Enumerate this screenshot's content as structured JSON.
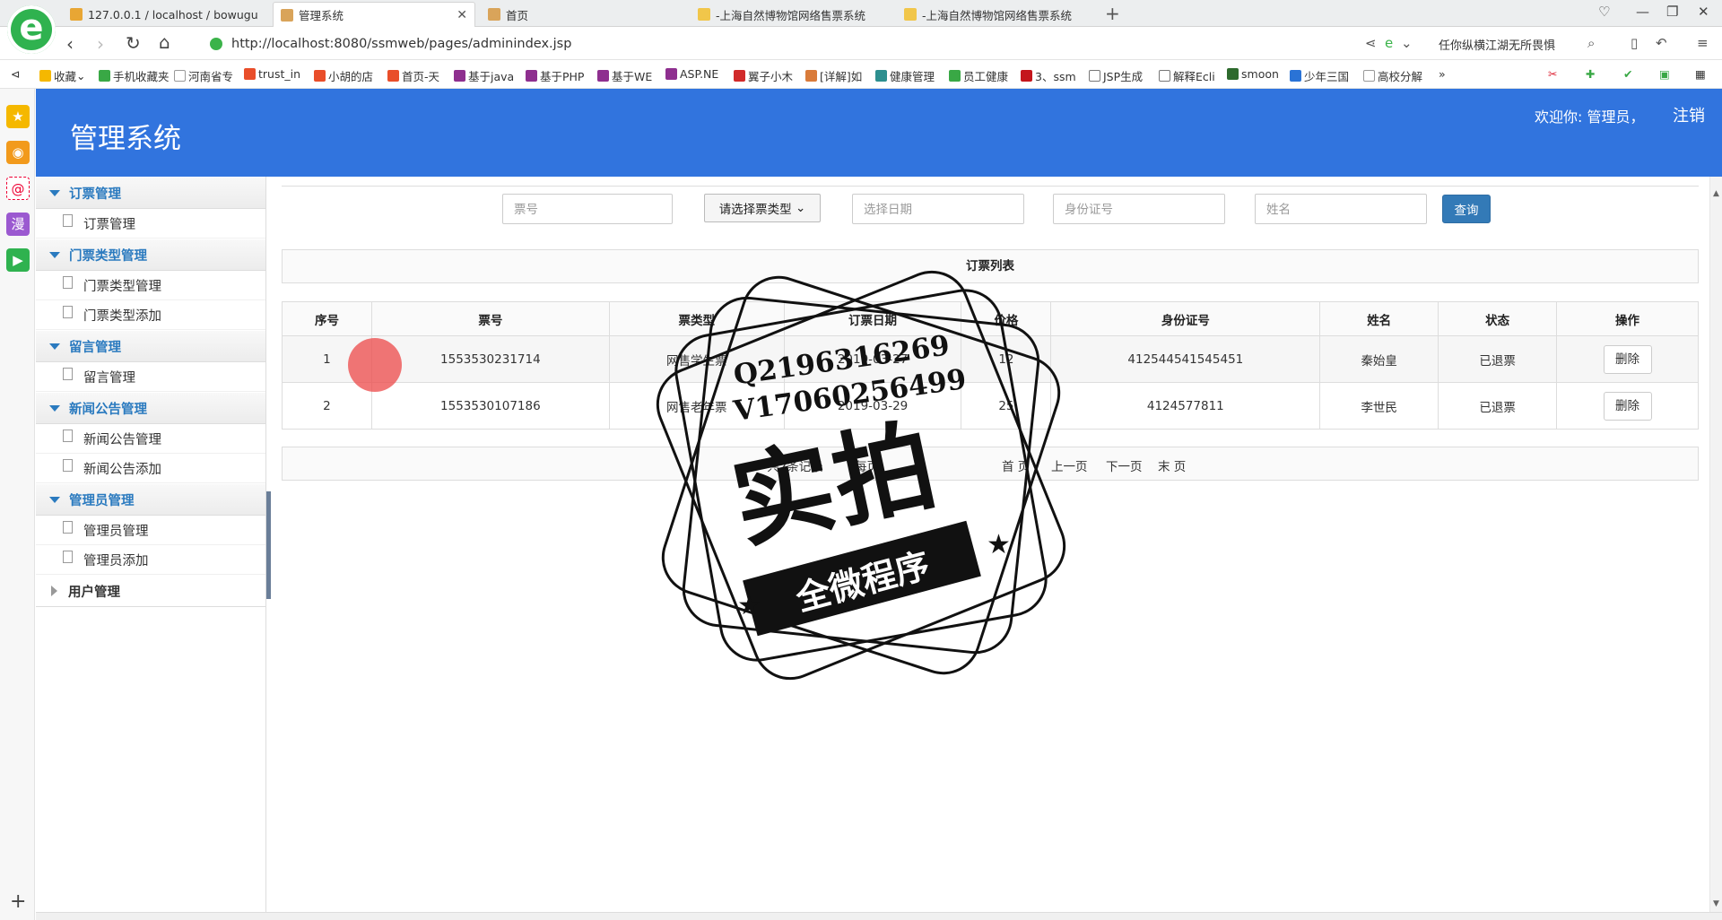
{
  "browser": {
    "tabs": [
      {
        "label": "127.0.0.1 / localhost / bowugu",
        "active": false
      },
      {
        "label": "管理系统",
        "active": true
      },
      {
        "label": "首页",
        "active": false
      },
      {
        "label": "-上海自然博物馆网络售票系统",
        "active": false
      },
      {
        "label": "-上海自然博物馆网络售票系统",
        "active": false
      }
    ],
    "url": "http://localhost:8080/ssmweb/pages/adminindex.jsp",
    "addr_right_text": "任你纵横江湖无所畏惧",
    "bookmarks": [
      "收藏",
      "手机收藏夹",
      "河南省专",
      "trust_in",
      "小胡的店",
      "首页-天",
      "基于java",
      "基于PHP",
      "基于WE",
      "ASP.NE",
      "翼子小木",
      "[详解]如",
      "健康管理",
      "员工健康",
      "3、ssm",
      "JSP生成",
      "解释Ecli",
      "smoon",
      "少年三国",
      "高校分解"
    ]
  },
  "header": {
    "title": "管理系统",
    "welcome": "欢迎你: 管理员，",
    "logout": "注销"
  },
  "sidebar": {
    "groups": [
      {
        "label": "订票管理",
        "items": [
          "订票管理"
        ]
      },
      {
        "label": "门票类型管理",
        "items": [
          "门票类型管理",
          "门票类型添加"
        ]
      },
      {
        "label": "留言管理",
        "items": [
          "留言管理"
        ]
      },
      {
        "label": "新闻公告管理",
        "items": [
          "新闻公告管理",
          "新闻公告添加"
        ]
      },
      {
        "label": "管理员管理",
        "items": [
          "管理员管理",
          "管理员添加"
        ]
      },
      {
        "label": "用户管理",
        "items": []
      }
    ]
  },
  "search": {
    "ticket_no_placeholder": "票号",
    "type_select": "请选择票类型",
    "date_placeholder": "选择日期",
    "id_placeholder": "身份证号",
    "name_placeholder": "姓名",
    "query_label": "查询"
  },
  "list": {
    "title": "订票列表",
    "columns": [
      "序号",
      "票号",
      "票类型",
      "订票日期",
      "价格",
      "身份证号",
      "姓名",
      "状态",
      "操作"
    ],
    "rows": [
      [
        "1",
        "1553530231714",
        "网售学生票",
        "2019-03-27",
        "12",
        "412544541545451",
        "秦始皇",
        "已退票",
        "删除"
      ],
      [
        "2",
        "1553530107186",
        "网售老年票",
        "2019-03-29",
        "25",
        "4124577811",
        "李世民",
        "已退票",
        "删除"
      ]
    ]
  },
  "pager": {
    "total": "共2条记录",
    "per_page": "每页",
    "first": "首 页",
    "prev": "上一页",
    "next": "下一页",
    "last": "末 页"
  },
  "watermark": {
    "qq": "Q2196316269",
    "vx": "V17060256499",
    "main": "实拍",
    "band": "全微程序"
  },
  "colors": {
    "header_bg": "#3174de",
    "menu_accent": "#2a7abf",
    "query_button": "#337ab7"
  }
}
